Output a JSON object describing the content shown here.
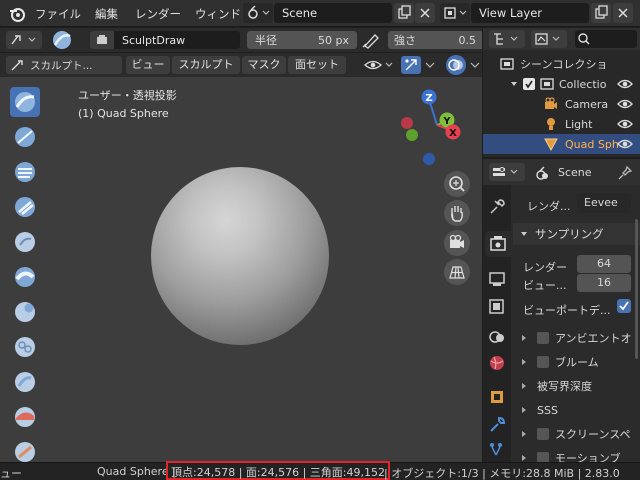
{
  "topbar": {
    "menus": [
      "ファイル",
      "編集",
      "レンダー",
      "ウィンド"
    ],
    "scene_name": "Scene",
    "view_layer": "View Layer"
  },
  "toolheader": {
    "brush_name": "SculptDraw",
    "radius_label": "半径",
    "radius_value": "50 px",
    "strength_label": "強さ",
    "strength_value": "0.5"
  },
  "modeheader": {
    "mode": "スカルプト...",
    "menus": [
      "ビュー",
      "スカルプト",
      "マスク",
      "面セット"
    ]
  },
  "viewport": {
    "view_label": "ユーザー・透視投影",
    "object_label": "(1) Quad Sphere",
    "gizmo_axes": [
      "Z",
      "Y",
      "X"
    ]
  },
  "outliner": {
    "title": "シーンコレクショ",
    "items": [
      "Collectio",
      "Camera",
      "Light",
      "Quad Sph"
    ]
  },
  "properties": {
    "scene_label": "Scene",
    "render_engine_label": "レンダ...",
    "render_engine_value": "Eevee",
    "sampling_title": "サンプリング",
    "render_samples_label": "レンダー",
    "render_samples_value": "64",
    "viewport_samples_label": "ビュー...",
    "viewport_samples_value": "16",
    "viewport_denoise_label": "ビューポートデ...",
    "panels": [
      "アンビエントオ",
      "ブルーム",
      "被写界深度",
      "SSS",
      "スクリーンスペ",
      "モーションブ"
    ]
  },
  "statusbar": {
    "left_text": "ュー",
    "object_name": "Quad Sphere |",
    "stats_highlight": "頂点:24,578 | 面:24,576 | 三角面:49,152",
    "rest": "| オブジェクト:1/3 | メモリ:28.8 MiB | 2.83.0"
  },
  "colors": {
    "accent": "#4772b3",
    "highlight_box": "#e0252b",
    "axis_x": "#e8404f",
    "axis_y": "#7fbf3a",
    "axis_z": "#3a73d8"
  }
}
